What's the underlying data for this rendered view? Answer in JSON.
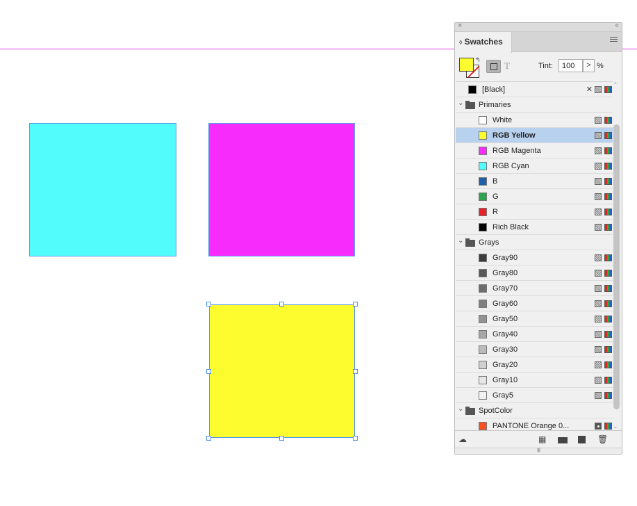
{
  "canvas": {
    "frames": [
      {
        "name": "cyan-frame",
        "color": "#52fcfc"
      },
      {
        "name": "magenta-frame",
        "color": "#f72cfc"
      },
      {
        "name": "yellow-frame",
        "color": "#fcfc2f",
        "selected": true
      }
    ]
  },
  "panel": {
    "close_icon": "×",
    "collapse_icon": "‹‹",
    "tab_arrow": "◊",
    "title": "Swatches",
    "fill_color": "#fcfc2f",
    "swap_icon": "↰",
    "text_icon": "T",
    "tint_label": "Tint:",
    "tint_value": "100",
    "tint_stepper": ">",
    "tint_unit": "%",
    "swatches": [
      {
        "type": "top",
        "name": "[Black]",
        "color": "#000000",
        "non_editable": true
      },
      {
        "type": "group",
        "name": "Primaries",
        "toggle": "⌄"
      },
      {
        "type": "item",
        "name": "White",
        "color": "#ffffff"
      },
      {
        "type": "item",
        "name": "RGB Yellow",
        "color": "#fcfc2f",
        "selected": true
      },
      {
        "type": "item",
        "name": "RGB Magenta",
        "color": "#f72cfc"
      },
      {
        "type": "item",
        "name": "RGB Cyan",
        "color": "#52fcfc"
      },
      {
        "type": "item",
        "name": "B",
        "color": "#1d5fa8"
      },
      {
        "type": "item",
        "name": "G",
        "color": "#2da44e"
      },
      {
        "type": "item",
        "name": "R",
        "color": "#e52129"
      },
      {
        "type": "item",
        "name": "Rich Black",
        "color": "#000000"
      },
      {
        "type": "group",
        "name": "Grays",
        "toggle": "⌄"
      },
      {
        "type": "item",
        "name": "Gray90",
        "color": "#3c3c3e"
      },
      {
        "type": "item",
        "name": "Gray80",
        "color": "#58585a"
      },
      {
        "type": "item",
        "name": "Gray70",
        "color": "#6c6c6e"
      },
      {
        "type": "item",
        "name": "Gray60",
        "color": "#808082"
      },
      {
        "type": "item",
        "name": "Gray50",
        "color": "#939395"
      },
      {
        "type": "item",
        "name": "Gray40",
        "color": "#a7a7a9"
      },
      {
        "type": "item",
        "name": "Gray30",
        "color": "#bbbbbd"
      },
      {
        "type": "item",
        "name": "Gray20",
        "color": "#d0d0d2"
      },
      {
        "type": "item",
        "name": "Gray10",
        "color": "#e6e6e7"
      },
      {
        "type": "item",
        "name": "Gray5",
        "color": "#f2f2f3"
      },
      {
        "type": "group",
        "name": "SpotColor",
        "toggle": "⌄"
      },
      {
        "type": "item",
        "name": "PANTONE Orange 0...",
        "color": "#fc4f1f",
        "spot": true
      }
    ],
    "scroll_up": "⌃",
    "scroll_down": "⌄",
    "bottom": {
      "cloud_icon": "☁",
      "grid_icon": "▦",
      "trash_icon": "🗑",
      "grip": "||||||||"
    }
  }
}
